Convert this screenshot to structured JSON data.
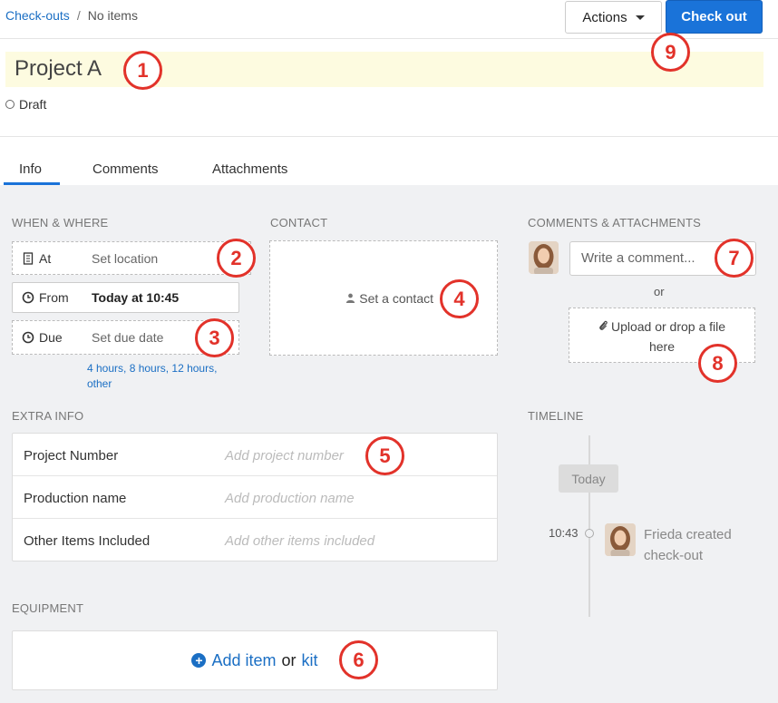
{
  "breadcrumb": {
    "root": "Check-outs",
    "separator": "/",
    "current": "No items"
  },
  "header": {
    "actions_label": "Actions",
    "checkout_label": "Check out",
    "title": "Project A",
    "status": "Draft"
  },
  "tabs": [
    {
      "label": "Info",
      "active": true
    },
    {
      "label": "Comments",
      "active": false
    },
    {
      "label": "Attachments",
      "active": false
    }
  ],
  "when_where": {
    "label": "WHEN & WHERE",
    "at": {
      "label": "At",
      "value": "Set location"
    },
    "from": {
      "label": "From",
      "value": "Today at 10:45"
    },
    "due": {
      "label": "Due",
      "value": "Set due date"
    },
    "quick_options": [
      "4 hours",
      "8 hours",
      "12 hours",
      "other"
    ]
  },
  "contact": {
    "label": "CONTACT",
    "placeholder": "Set a contact"
  },
  "comments": {
    "label": "COMMENTS & ATTACHMENTS",
    "placeholder": "Write a comment...",
    "or": "or",
    "upload_line1": "Upload or drop a file",
    "upload_line2": "here"
  },
  "extra_info": {
    "label": "EXTRA INFO",
    "rows": [
      {
        "key": "Project Number",
        "placeholder": "Add project number"
      },
      {
        "key": "Production name",
        "placeholder": "Add production name"
      },
      {
        "key": "Other Items Included",
        "placeholder": "Add other items included"
      }
    ]
  },
  "timeline": {
    "label": "TIMELINE",
    "day": "Today",
    "event_time": "10:43",
    "event_line1": "Frieda created",
    "event_line2": "check-out"
  },
  "equipment": {
    "label": "EQUIPMENT",
    "add_item": "Add item",
    "or": "or",
    "kit": "kit"
  },
  "callouts": [
    "1",
    "2",
    "3",
    "4",
    "5",
    "6",
    "7",
    "8",
    "9"
  ],
  "colors": {
    "accent": "#1a73d9",
    "callout": "#e2322a",
    "title_highlight": "#fdfbe0"
  }
}
